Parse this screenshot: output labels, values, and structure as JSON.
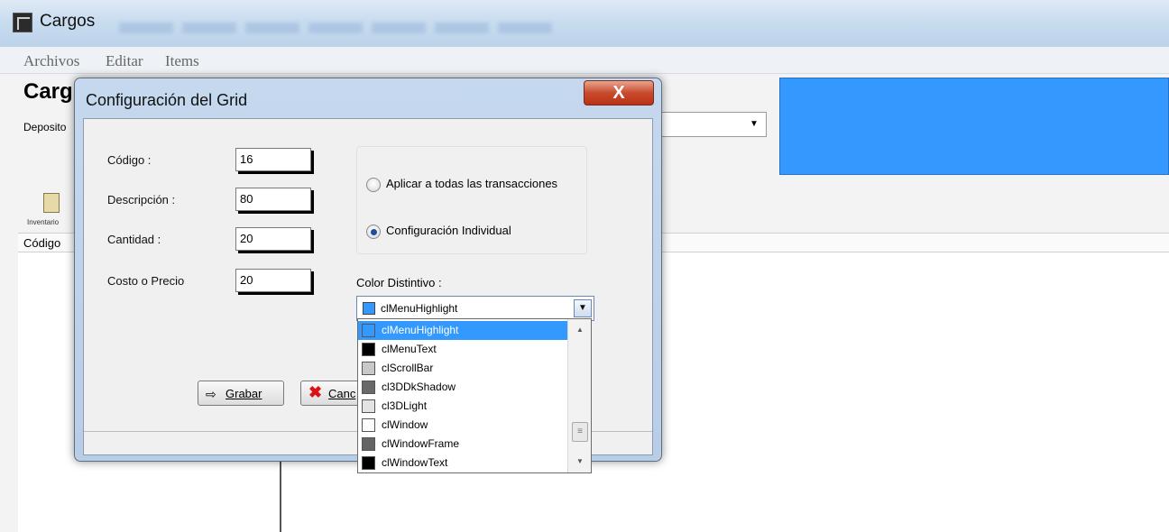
{
  "window": {
    "title": "Cargos"
  },
  "menu": {
    "items": [
      "Archivos",
      "Editar",
      "Items"
    ]
  },
  "document": {
    "title": "Carg",
    "deposito_label": "Deposito",
    "toolbar_inventario_label": "Inventario",
    "grid_column_codigo": "Código",
    "blue_panel_color": "#3399ff"
  },
  "dialog": {
    "title": "Configuración del Grid",
    "close_glyph": "X",
    "fields": [
      {
        "label": "Código :",
        "value": "16"
      },
      {
        "label": "Descripción :",
        "value": "80"
      },
      {
        "label": "Cantidad :",
        "value": "20"
      },
      {
        "label": "Costo o Precio",
        "value": "20"
      }
    ],
    "radio_all": {
      "label": "Aplicar a todas las transacciones",
      "checked": false
    },
    "radio_individual": {
      "label": "Configuración Individual",
      "checked": true
    },
    "color_label": "Color Distintivo :",
    "color_selected": {
      "name": "clMenuHighlight",
      "color": "#3399ff"
    },
    "buttons": {
      "grabar": "Grabar",
      "cancel": "Canc"
    }
  },
  "dropdown": {
    "options": [
      {
        "name": "clMenuHighlight",
        "color": "#3399ff",
        "selected": true
      },
      {
        "name": "clMenuText",
        "color": "#000000",
        "selected": false
      },
      {
        "name": "clScrollBar",
        "color": "#c8c8c8",
        "selected": false
      },
      {
        "name": "cl3DDkShadow",
        "color": "#696969",
        "selected": false
      },
      {
        "name": "cl3DLight",
        "color": "#e3e3e3",
        "selected": false
      },
      {
        "name": "clWindow",
        "color": "#ffffff",
        "selected": false
      },
      {
        "name": "clWindowFrame",
        "color": "#646464",
        "selected": false
      },
      {
        "name": "clWindowText",
        "color": "#000000",
        "selected": false
      }
    ]
  }
}
